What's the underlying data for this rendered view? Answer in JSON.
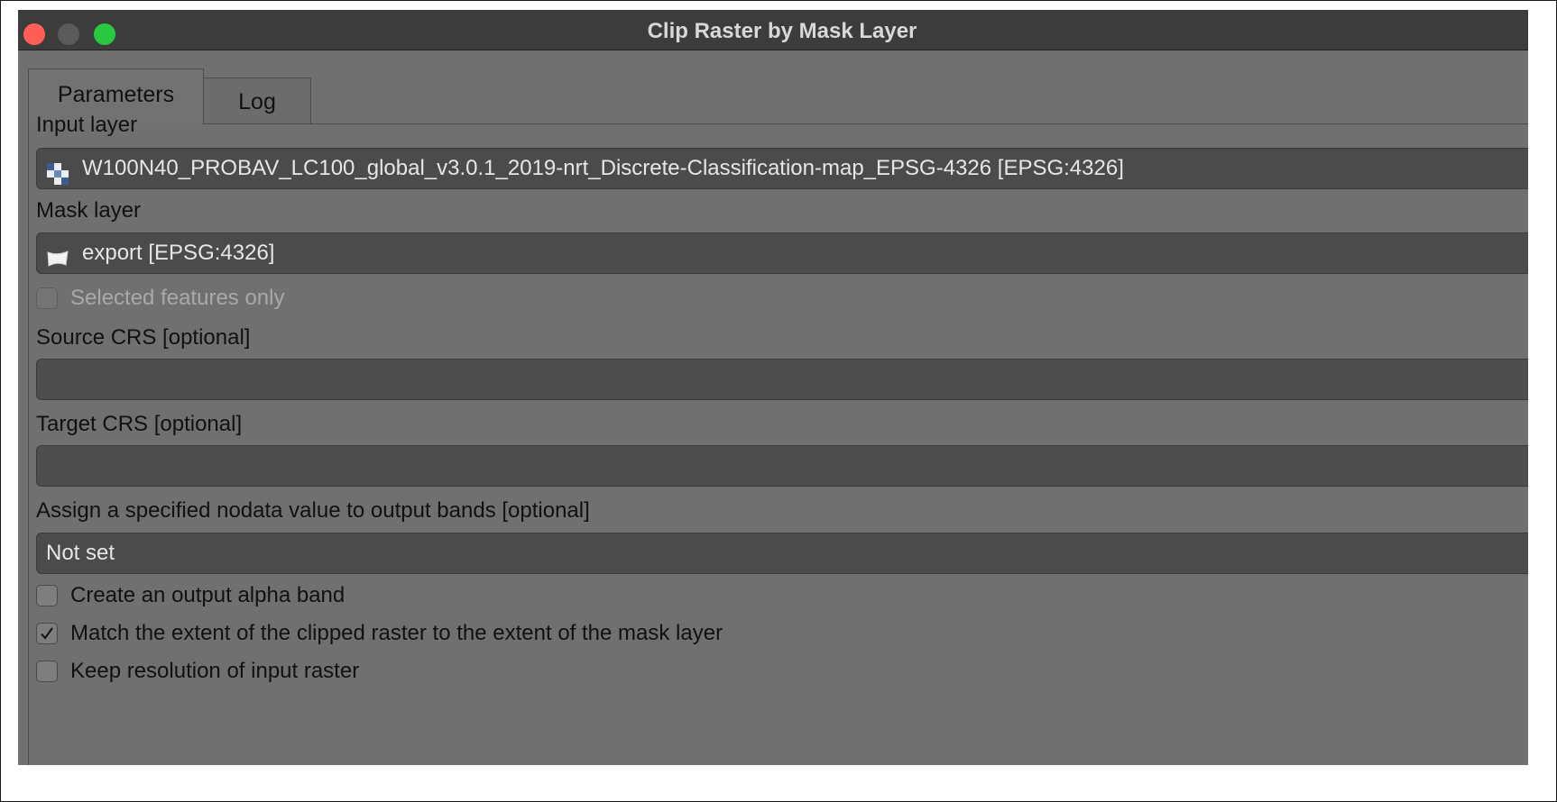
{
  "window": {
    "title": "Clip Raster by Mask Layer"
  },
  "tabs": [
    {
      "label": "Parameters"
    },
    {
      "label": "Log"
    }
  ],
  "form": {
    "input_layer": {
      "label": "Input layer",
      "value": "W100N40_PROBAV_LC100_global_v3.0.1_2019-nrt_Discrete-Classification-map_EPSG-4326 [EPSG:4326]",
      "icon": "raster-layer-icon"
    },
    "mask_layer": {
      "label": "Mask layer",
      "value": "export [EPSG:4326]",
      "icon": "polygon-layer-icon"
    },
    "selected_features_only": {
      "label": "Selected features only",
      "checked": false,
      "enabled": false
    },
    "source_crs": {
      "label": "Source CRS [optional]",
      "value": ""
    },
    "target_crs": {
      "label": "Target CRS [optional]",
      "value": ""
    },
    "nodata": {
      "label": "Assign a specified nodata value to output bands [optional]",
      "value": "Not set"
    },
    "alpha_band": {
      "label": "Create an output alpha band",
      "checked": false
    },
    "match_extent": {
      "label": "Match the extent of the clipped raster to the extent of the mask layer",
      "checked": true
    },
    "keep_resolution": {
      "label": "Keep resolution of input raster",
      "checked": false
    }
  },
  "colors": {
    "close": "#ff5f57",
    "maximize": "#28c840",
    "panel": "#707070",
    "field": "#4b4b4b"
  }
}
